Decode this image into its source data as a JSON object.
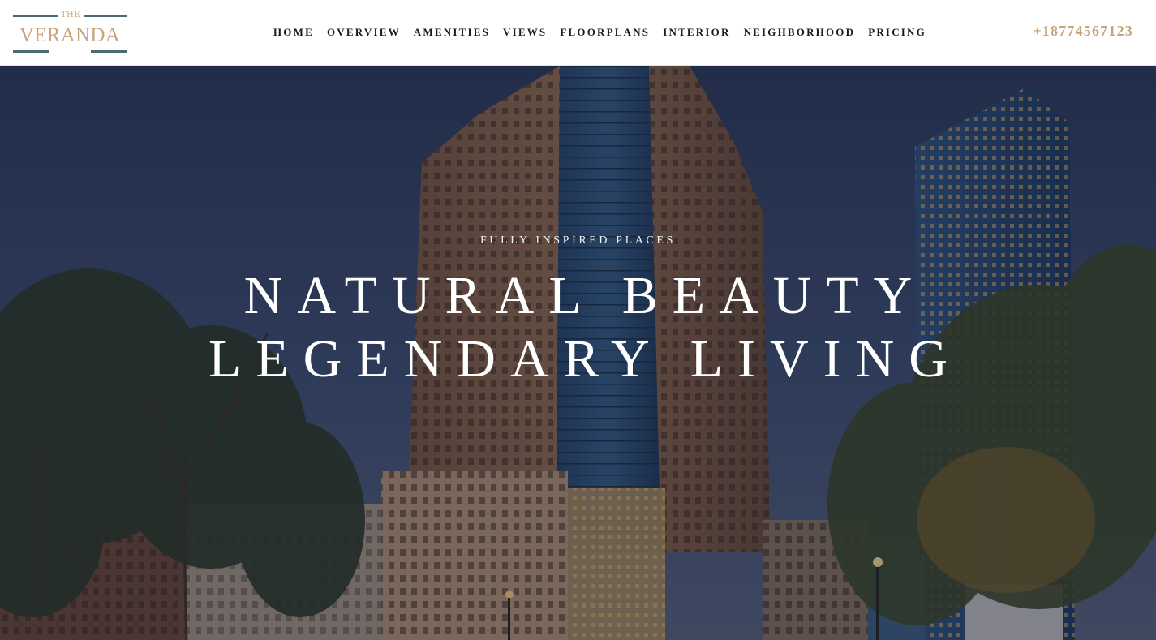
{
  "brand": {
    "small": "THE",
    "name": "VERANDA"
  },
  "nav": {
    "items": [
      {
        "label": "HOME"
      },
      {
        "label": "OVERVIEW"
      },
      {
        "label": "AMENITIES"
      },
      {
        "label": "VIEWS"
      },
      {
        "label": "FLOORPLANS"
      },
      {
        "label": "INTERIOR"
      },
      {
        "label": "NEIGHBORHOOD"
      },
      {
        "label": "PRICING"
      }
    ]
  },
  "header": {
    "phone": "+18774567123"
  },
  "hero": {
    "eyebrow": "FULLY INSPIRED PLACES",
    "line1": "NATURAL BEAUTY",
    "line2": "LEGENDARY LIVING"
  },
  "colors": {
    "accent": "#c9a37a",
    "logo_lines": "#4f6b72",
    "nav_text": "#1b1b1b",
    "sky": "#2e3f63"
  }
}
